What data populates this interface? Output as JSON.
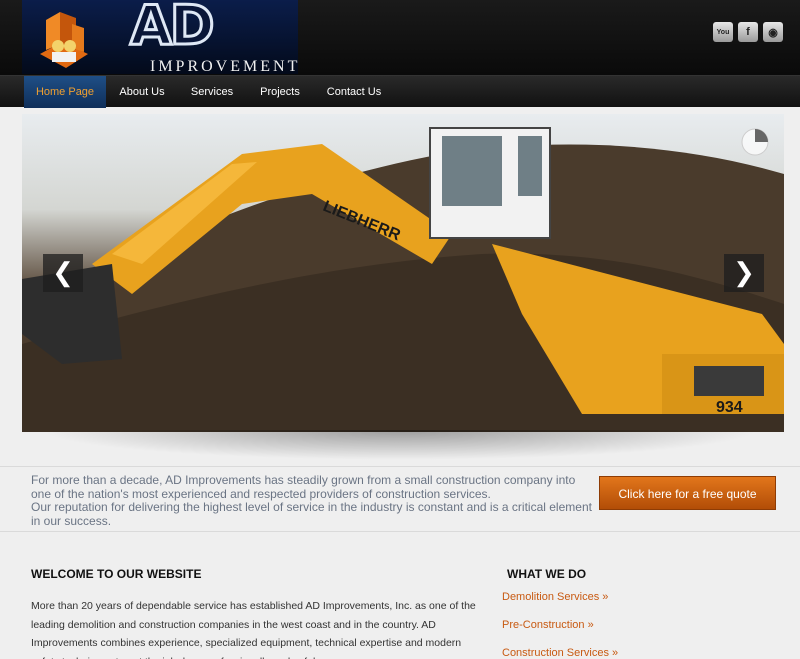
{
  "header": {
    "logo_letters": "AD",
    "logo_word": "IMPROVEMENTS",
    "social": [
      {
        "name": "youtube-icon",
        "glyph": "You"
      },
      {
        "name": "facebook-icon",
        "glyph": "f"
      },
      {
        "name": "rss-icon",
        "glyph": "◉"
      }
    ]
  },
  "nav": {
    "items": [
      {
        "label": "Home Page"
      },
      {
        "label": "About Us"
      },
      {
        "label": "Services"
      },
      {
        "label": "Projects"
      },
      {
        "label": "Contact Us"
      }
    ]
  },
  "slider": {
    "prev_glyph": "❮",
    "next_glyph": "❯",
    "machine_brand": "LIEBHERR",
    "machine_number": "934"
  },
  "intro": {
    "line1": "For more than a decade, AD Improvements has steadily grown from a small construction company into one of the nation's most experienced and respected providers of construction services.",
    "line2": "Our reputation for delivering the highest level of service in the industry is constant and is a critical element in our success.",
    "quote_button": "Click here for a free quote"
  },
  "welcome": {
    "heading": "WELCOME TO OUR WEBSITE",
    "body": "More than 20 years of dependable service has established AD Improvements, Inc. as one of the leading demolition and construction companies in the west coast and in the country. AD Improvements combines experience, specialized equipment, technical expertise and modern safety techniques to get the job done professionally and safely."
  },
  "what_we_do": {
    "heading": "WHAT WE DO",
    "services": [
      {
        "label": "Demolition Services »"
      },
      {
        "label": "Pre-Construction »"
      },
      {
        "label": "Construction Services »"
      }
    ]
  }
}
